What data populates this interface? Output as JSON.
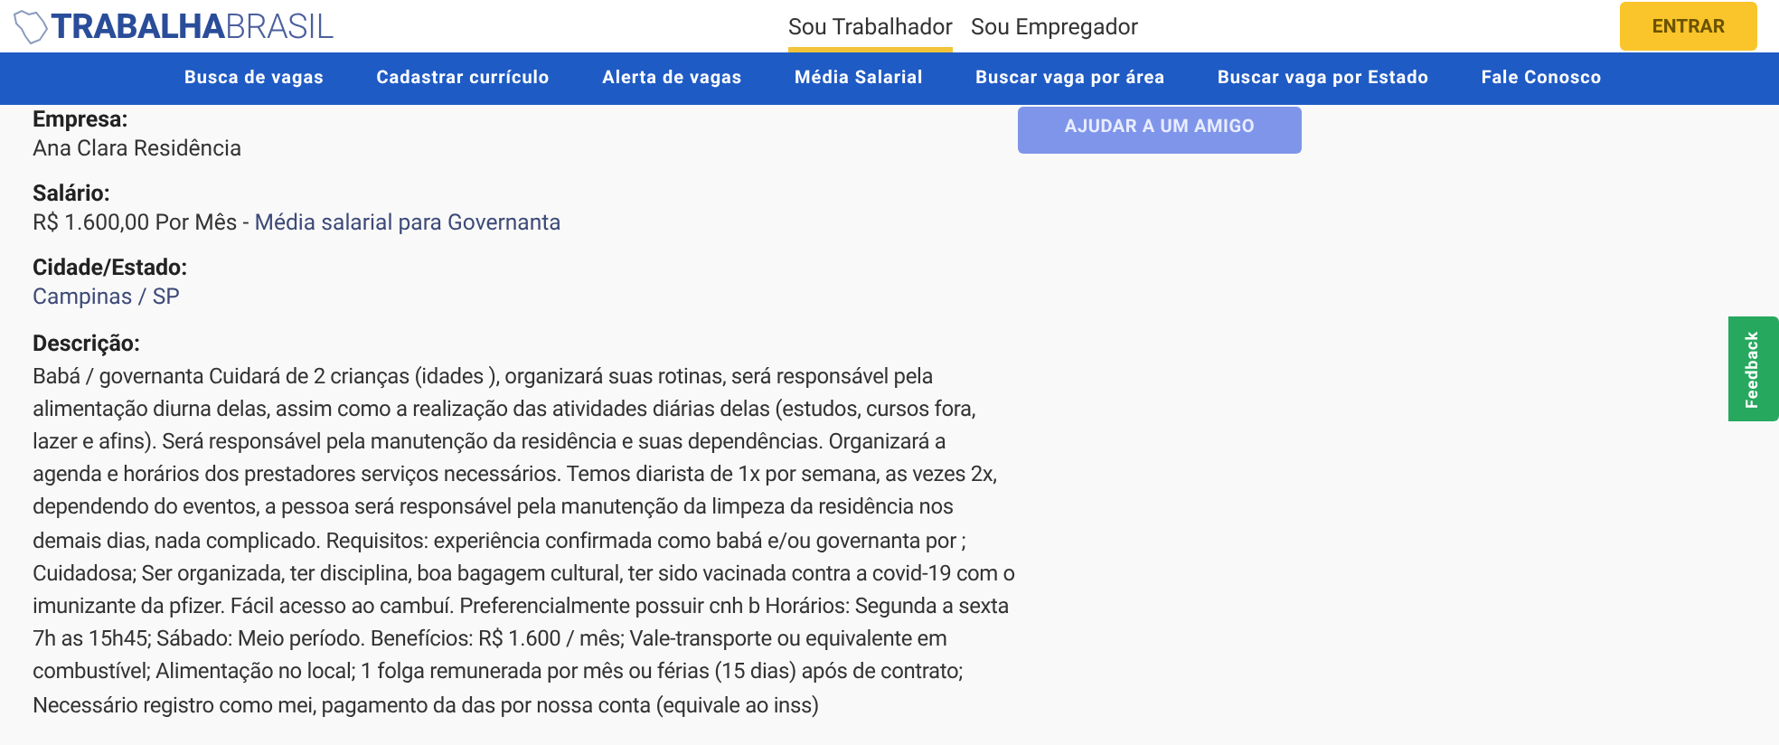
{
  "logo": "**TRABALHA**BRASIL",
  "tabs": [
    {
      "label": "Sou Trabalhador",
      "selected": true
    },
    {
      "label": "Sou Empregador",
      "selected": false
    }
  ],
  "login_button": "ENTRAR",
  "nav": [
    "Busca de vagas",
    "Cadastrar currículo",
    "Alerta de vagas",
    "Média Salarial",
    "Buscar vaga por área",
    "Buscar vaga por Estado",
    "Fale Conosco"
  ],
  "help_button": "AJUDAR A UM AMIGO",
  "fields": [
    {
      "label": "Empresa:",
      "value": "Ana Clara Residência",
      "kind": "text"
    },
    {
      "label": "Salário:",
      "value": "R$ 1.600,00 Por Mês - ",
      "link": "Média salarial para Governanta",
      "kind": "text"
    },
    {
      "label": "Cidade/Estado:",
      "value": "Campinas / SP",
      "kind": "link"
    },
    {
      "label": "Descrição:",
      "value": "Babá / governanta Cuidará de 2 crianças (idades ), organizará suas rotinas, será responsável pela alimentação diurna delas, assim como a realização das atividades diárias delas (estudos, cursos fora, lazer e afins). Será responsável pela manutenção da residência e suas dependências. Organizará a agenda e horários dos prestadores serviços necessários. Temos diarista de 1x por semana, as vezes 2x, dependendo do eventos, a pessoa será responsável pela manutenção da limpeza da residência nos demais dias, nada complicado. Requisitos: experiência confirmada como babá e/ou governanta por ; Cuidadosa; Ser organizada, ter disciplina, boa bagagem cultural, ter sido vacinada contra a covid-19 com o imunizante da pfizer. Fácil acesso ao cambuí. Preferencialmente possuir cnh b Horários: Segunda a sexta 7h as 15h45; Sábado: Meio período. Benefícios: R$ 1.600 / mês; Vale-transporte ou equivalente em combustível; Alimentação no local; 1 folga remunerada por mês ou férias (15 dias) após de contrato; Necessário registro como mei, pagamento da das por nossa conta (equivale ao inss)",
      "kind": "text"
    }
  ],
  "feedback_tab": "Feedback"
}
